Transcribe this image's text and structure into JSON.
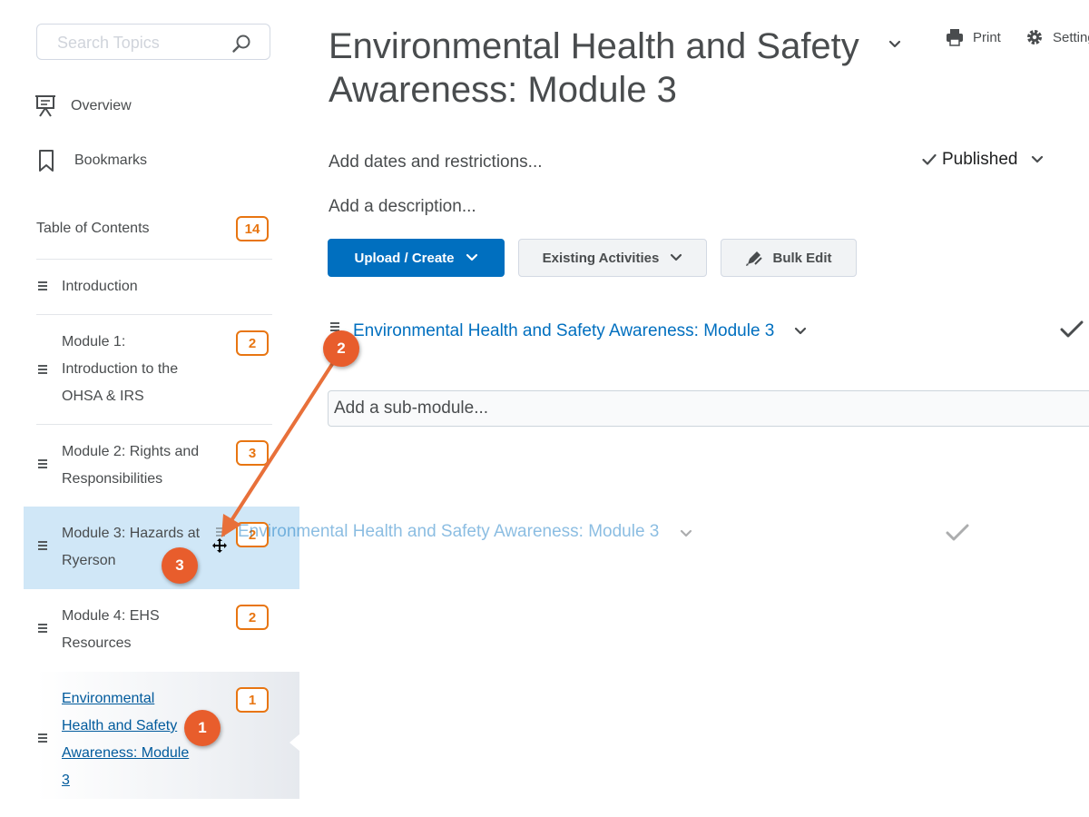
{
  "sidebar": {
    "search_placeholder": "Search Topics",
    "nav": [
      {
        "label": "Overview",
        "icon": "presentation-icon"
      },
      {
        "label": "Bookmarks",
        "icon": "bookmark-icon"
      }
    ],
    "toc": {
      "label": "Table of Contents",
      "count": "14",
      "items": [
        {
          "label": "Introduction"
        },
        {
          "lines": [
            "Module 1:",
            "Introduction to the",
            "OHSA & IRS"
          ],
          "count": "2"
        },
        {
          "lines": [
            "Module 2: Rights and",
            "Responsibilities"
          ],
          "count": "3"
        },
        {
          "lines": [
            "Module 3: Hazards at",
            "Ryerson"
          ],
          "count": "2",
          "state": "drop-target"
        },
        {
          "lines": [
            "Module 4: EHS",
            "Resources"
          ],
          "count": "2"
        },
        {
          "lines": [
            "Environmental",
            "Health and Safety",
            "Awareness: Module",
            "3"
          ],
          "count": "1",
          "state": "active"
        }
      ]
    }
  },
  "main": {
    "title_lines": [
      "Environmental Health and Safety",
      "Awareness: Module 3"
    ],
    "toolbar": {
      "print": "Print",
      "settings": "Settings"
    },
    "add_dates": "Add dates and restrictions...",
    "add_description": "Add a description...",
    "status": "Published",
    "buttons": {
      "upload": "Upload / Create",
      "existing": "Existing Activities",
      "bulk_edit": "Bulk Edit"
    },
    "module_heading": "Environmental Health and Safety Awareness: Module 3",
    "submodule_placeholder": "Add a sub-module...",
    "drag_preview": "Environmental Health and Safety Awareness: Module 3"
  },
  "annotations": {
    "callout_1": "1",
    "callout_2": "2",
    "callout_3": "3"
  },
  "colors": {
    "accent": "#006fbf",
    "badge": "#e87511",
    "callout": "#e85d2c",
    "selected_row": "#d0e7f7",
    "arrow": "#e8703a"
  }
}
